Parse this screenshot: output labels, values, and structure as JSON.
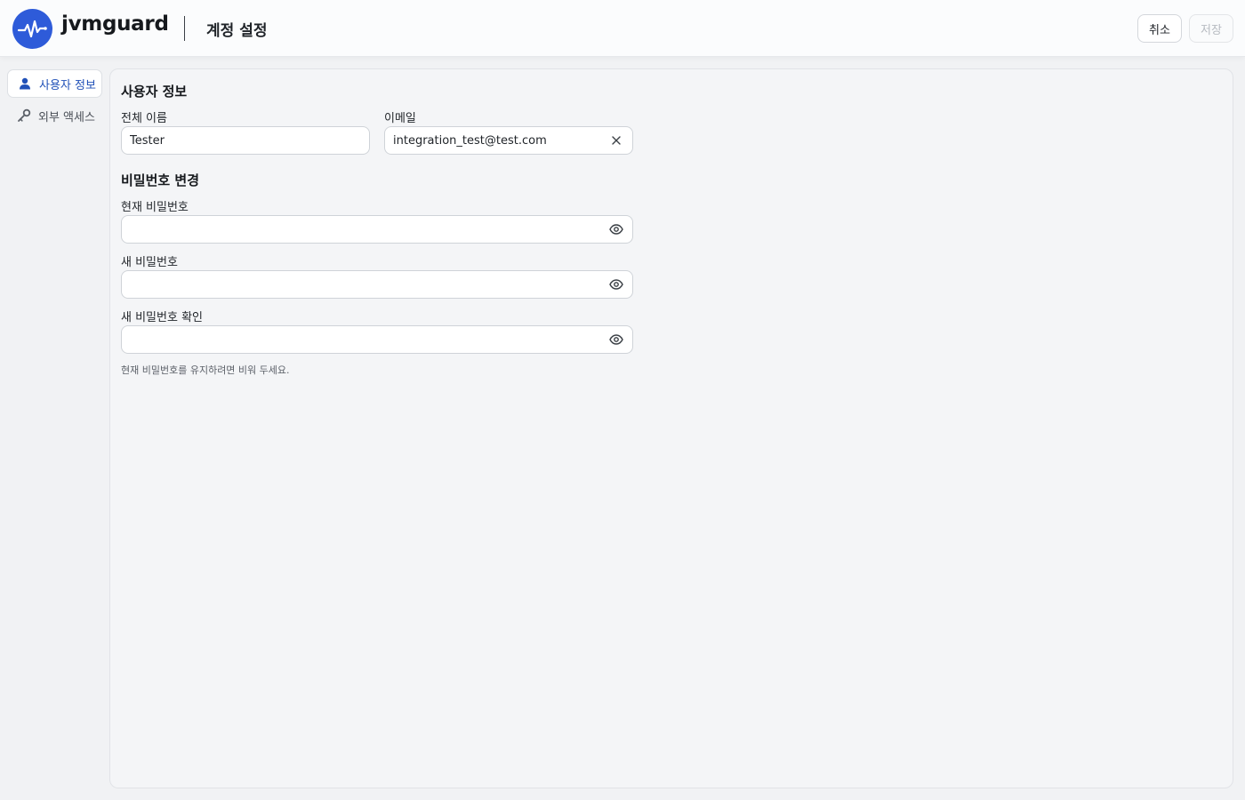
{
  "header": {
    "brand": "jvmguard",
    "page_title": "계정 설정",
    "cancel_label": "취소",
    "save_label": "저장",
    "accent_color": "#2e5bd9"
  },
  "sidebar": {
    "items": [
      {
        "label": "사용자 정보",
        "icon": "user-icon",
        "active": true
      },
      {
        "label": "외부 액세스",
        "icon": "key-icon",
        "active": false
      }
    ]
  },
  "user_info": {
    "title": "사용자 정보",
    "full_name_label": "전체 이름",
    "full_name_value": "Tester",
    "email_label": "이메일",
    "email_value": "integration_test@test.com"
  },
  "password": {
    "title": "비밀번호 변경",
    "current_label": "현재 비밀번호",
    "current_value": "",
    "new_label": "새 비밀번호",
    "new_value": "",
    "confirm_label": "새 비밀번호 확인",
    "confirm_value": "",
    "hint": "현재 비밀번호를 유지하려면 비워 두세요."
  }
}
